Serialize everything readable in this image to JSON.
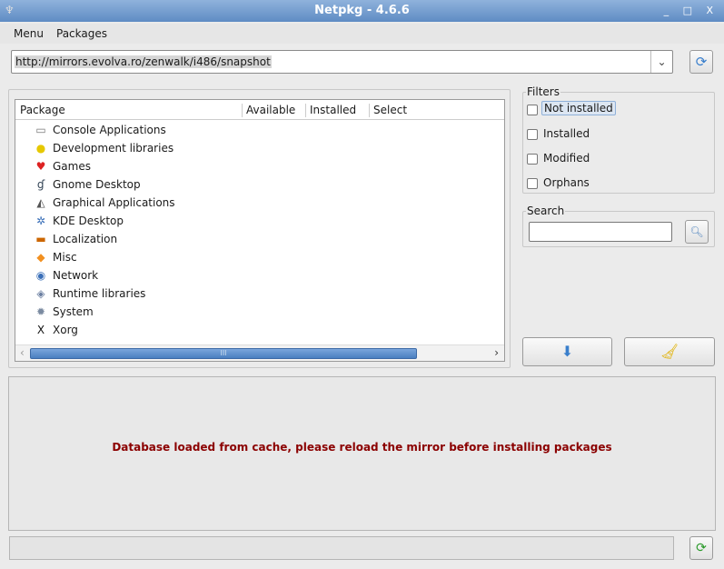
{
  "window": {
    "title": "Netpkg - 4.6.6",
    "controls": "_ □ X"
  },
  "menubar": {
    "items": [
      "Menu",
      "Packages"
    ]
  },
  "mirror": {
    "url": "http://mirrors.evolva.ro/zenwalk/i486/snapshot"
  },
  "tree": {
    "columns": [
      "Package",
      "Available",
      "Installed",
      "Select"
    ],
    "items": [
      {
        "label": "Console Applications",
        "icon": "terminal-icon",
        "glyph": "▭",
        "color": "#777"
      },
      {
        "label": "Development libraries",
        "icon": "library-icon",
        "glyph": "●",
        "color": "#e6c800"
      },
      {
        "label": "Games",
        "icon": "cards-icon",
        "glyph": "♥",
        "color": "#d22"
      },
      {
        "label": "Gnome Desktop",
        "icon": "gnome-foot-icon",
        "glyph": "ɠ",
        "color": "#345"
      },
      {
        "label": "Graphical Applications",
        "icon": "graphics-icon",
        "glyph": "◭",
        "color": "#555"
      },
      {
        "label": "KDE Desktop",
        "icon": "kde-gear-icon",
        "glyph": "✲",
        "color": "#3a6fb8"
      },
      {
        "label": "Localization",
        "icon": "flag-icon",
        "glyph": "▬",
        "color": "#c60"
      },
      {
        "label": "Misc",
        "icon": "misc-icon",
        "glyph": "◆",
        "color": "#f29020"
      },
      {
        "label": "Network",
        "icon": "globe-icon",
        "glyph": "◉",
        "color": "#3a6fb8"
      },
      {
        "label": "Runtime libraries",
        "icon": "diamond-icon",
        "glyph": "◈",
        "color": "#6a7ea0"
      },
      {
        "label": "System",
        "icon": "gear-icon",
        "glyph": "✹",
        "color": "#7a8aa0"
      },
      {
        "label": "Xorg",
        "icon": "x-logo-icon",
        "glyph": "X",
        "color": "#111"
      }
    ]
  },
  "filters": {
    "title": "Filters",
    "options": [
      "Not installed",
      "Installed",
      "Modified",
      "Orphans"
    ]
  },
  "search": {
    "title": "Search",
    "value": ""
  },
  "message": "Database loaded from cache, please reload the mirror before installing packages",
  "status": ""
}
